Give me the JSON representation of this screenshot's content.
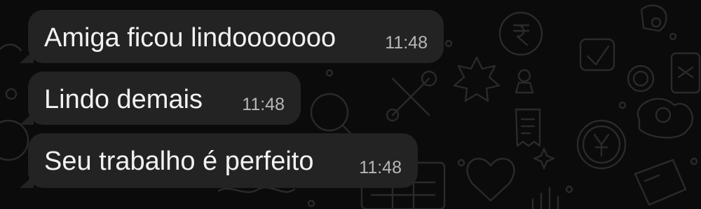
{
  "conversation": {
    "messages": [
      {
        "text": "Amiga ficou lindooooooo",
        "time": "11:48"
      },
      {
        "text": "Lindo demais",
        "time": "11:48"
      },
      {
        "text": "Seu trabalho é perfeito",
        "time": "11:48"
      }
    ]
  },
  "theme": {
    "background": "#0b0b0b",
    "bubble": "#232323",
    "text": "#f2f2f2",
    "timestamp": "#b7b7b7",
    "doodle": "#2a2a2a"
  },
  "icons": [
    "rupee-coin-icon",
    "yen-coin-icon",
    "tools-icon",
    "magnifier-icon",
    "star-burst-icon",
    "receipt-icon",
    "heart-icon",
    "sparkle-icon",
    "bell-icon",
    "chart-board-icon",
    "flower-icon"
  ]
}
